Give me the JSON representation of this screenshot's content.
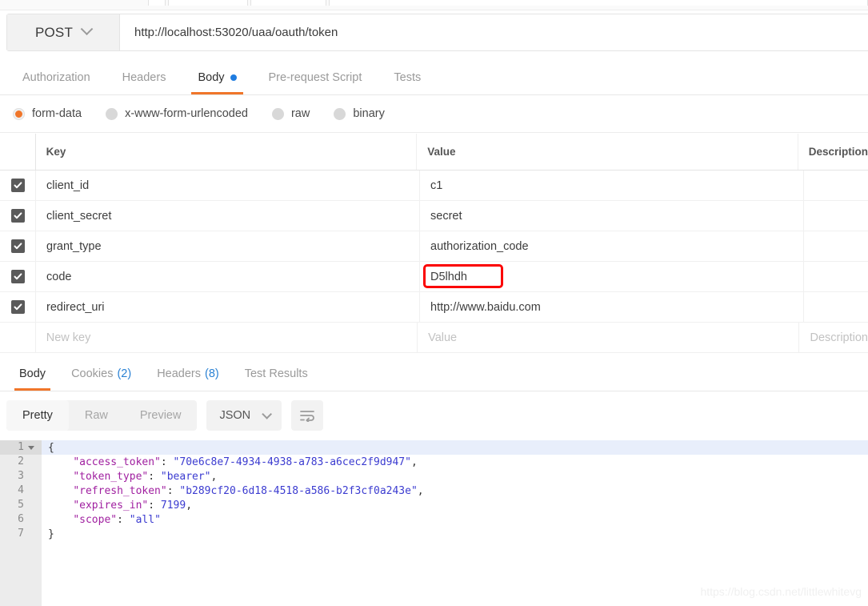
{
  "request": {
    "method": "POST",
    "url": "http://localhost:53020/uaa/oauth/token",
    "tabs": [
      {
        "label": "Authorization",
        "active": false,
        "dot": false
      },
      {
        "label": "Headers",
        "active": false,
        "dot": false
      },
      {
        "label": "Body",
        "active": true,
        "dot": true
      },
      {
        "label": "Pre-request Script",
        "active": false,
        "dot": false
      },
      {
        "label": "Tests",
        "active": false,
        "dot": false
      }
    ],
    "body_types": [
      {
        "label": "form-data",
        "selected": true
      },
      {
        "label": "x-www-form-urlencoded",
        "selected": false
      },
      {
        "label": "raw",
        "selected": false
      },
      {
        "label": "binary",
        "selected": false
      }
    ],
    "table": {
      "headers": {
        "key": "Key",
        "value": "Value",
        "description": "Description"
      },
      "rows": [
        {
          "checked": true,
          "key": "client_id",
          "value": "c1",
          "description": "",
          "highlight": false
        },
        {
          "checked": true,
          "key": "client_secret",
          "value": "secret",
          "description": "",
          "highlight": false
        },
        {
          "checked": true,
          "key": "grant_type",
          "value": "authorization_code",
          "description": "",
          "highlight": false
        },
        {
          "checked": true,
          "key": "code",
          "value": "D5lhdh",
          "description": "",
          "highlight": true
        },
        {
          "checked": true,
          "key": "redirect_uri",
          "value": "http://www.baidu.com",
          "description": "",
          "highlight": false
        }
      ],
      "placeholder_row": {
        "key": "New key",
        "value": "Value",
        "description": "Description"
      }
    }
  },
  "response": {
    "tabs": [
      {
        "label": "Body",
        "count": "",
        "active": true
      },
      {
        "label": "Cookies",
        "count": "(2)",
        "active": false
      },
      {
        "label": "Headers",
        "count": "(8)",
        "active": false
      },
      {
        "label": "Test Results",
        "count": "",
        "active": false
      }
    ],
    "view_modes": [
      {
        "label": "Pretty",
        "active": true
      },
      {
        "label": "Raw",
        "active": false
      },
      {
        "label": "Preview",
        "active": false
      }
    ],
    "format": "JSON",
    "wrap_icon": "word-wrap-icon",
    "body_json": {
      "access_token": "70e6c8e7-4934-4938-a783-a6cec2f9d947",
      "token_type": "bearer",
      "refresh_token": "b289cf20-6d18-4518-a586-b2f3cf0a243e",
      "expires_in": 7199,
      "scope": "all"
    },
    "line_numbers": [
      "1",
      "2",
      "3",
      "4",
      "5",
      "6",
      "7"
    ]
  },
  "watermark": "https://blog.csdn.net/littlewhitevg",
  "colors": {
    "accent_orange": "#f0762a",
    "blue_dot": "#1f7ce0",
    "highlight_red": "#fb0000",
    "json_key": "#a020a0",
    "json_value": "#3b3bd0"
  }
}
